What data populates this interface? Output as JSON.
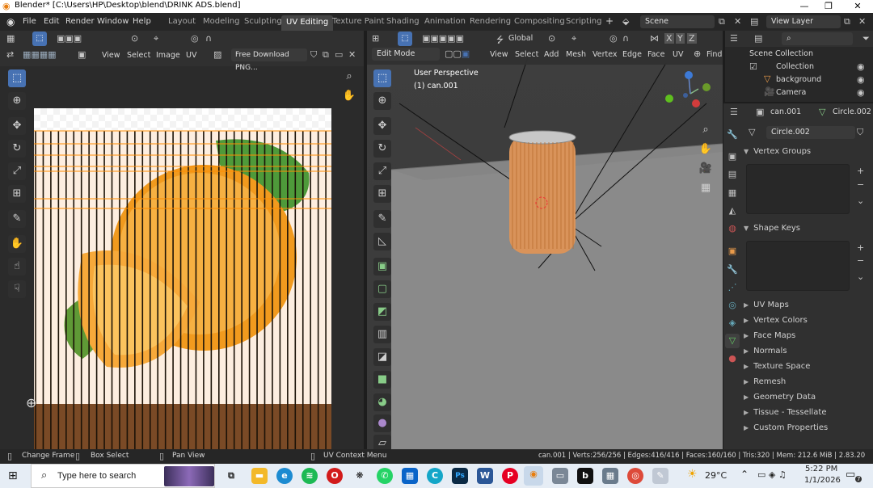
{
  "window": {
    "title": "Blender* [C:\\Users\\HP\\Desktop\\blend\\DRINK ADS.blend]",
    "minimize": "—",
    "maximize": "❐",
    "close": "✕"
  },
  "menubar": {
    "items": [
      "File",
      "Edit",
      "Render",
      "Window",
      "Help"
    ],
    "workspaces": [
      "Layout",
      "Modeling",
      "Sculpting",
      "UV Editing",
      "Texture Paint",
      "Shading",
      "Animation",
      "Rendering",
      "Compositing",
      "Scripting"
    ],
    "active_workspace": "UV Editing",
    "add": "+",
    "scene": "Scene",
    "view_layer": "View Layer"
  },
  "uv_editor": {
    "menus": [
      "View",
      "Select",
      "Image",
      "UV"
    ],
    "image_name": "Free Download PNG..."
  },
  "viewport": {
    "orientation": "Global",
    "mode": "Edit Mode",
    "menus": [
      "View",
      "Select",
      "Add",
      "Mesh",
      "Vertex",
      "Edge",
      "Face",
      "UV"
    ],
    "find": "Find",
    "perspective": "User Perspective",
    "object_label": "(1) can.001",
    "axes": [
      "X",
      "Y",
      "Z"
    ]
  },
  "outliner": {
    "search_placeholder": "",
    "title": "Scene Collection",
    "items": [
      "Collection",
      "background",
      "Camera"
    ]
  },
  "properties": {
    "object": "can.001",
    "mesh_tab": "Circle.002",
    "mesh_name": "Circle.002",
    "sections": [
      "Vertex Groups",
      "Shape Keys"
    ],
    "collapsed": [
      "UV Maps",
      "Vertex Colors",
      "Face Maps",
      "Normals",
      "Texture Space",
      "Remesh",
      "Geometry Data",
      "Tissue - Tessellate",
      "Custom Properties"
    ]
  },
  "statusbar": {
    "left": [
      "Change Frame",
      "Box Select",
      "Pan View",
      "UV Context Menu"
    ],
    "stats": "can.001 | Verts:256/256 | Edges:416/416 | Faces:160/160 | Tris:320 | Mem: 212.6 MiB | 2.83.20"
  },
  "taskbar": {
    "search_placeholder": "Type here to search",
    "weather": "29°C",
    "time": "5:22 PM",
    "date": "1/1/2026",
    "notif_count": "7"
  },
  "colors": {
    "accent": "#4772b3",
    "active_tab": "#454545",
    "uv_edge": "#ff8c00",
    "can_body": "#d9935a",
    "taskbar": "#e6edf5"
  }
}
